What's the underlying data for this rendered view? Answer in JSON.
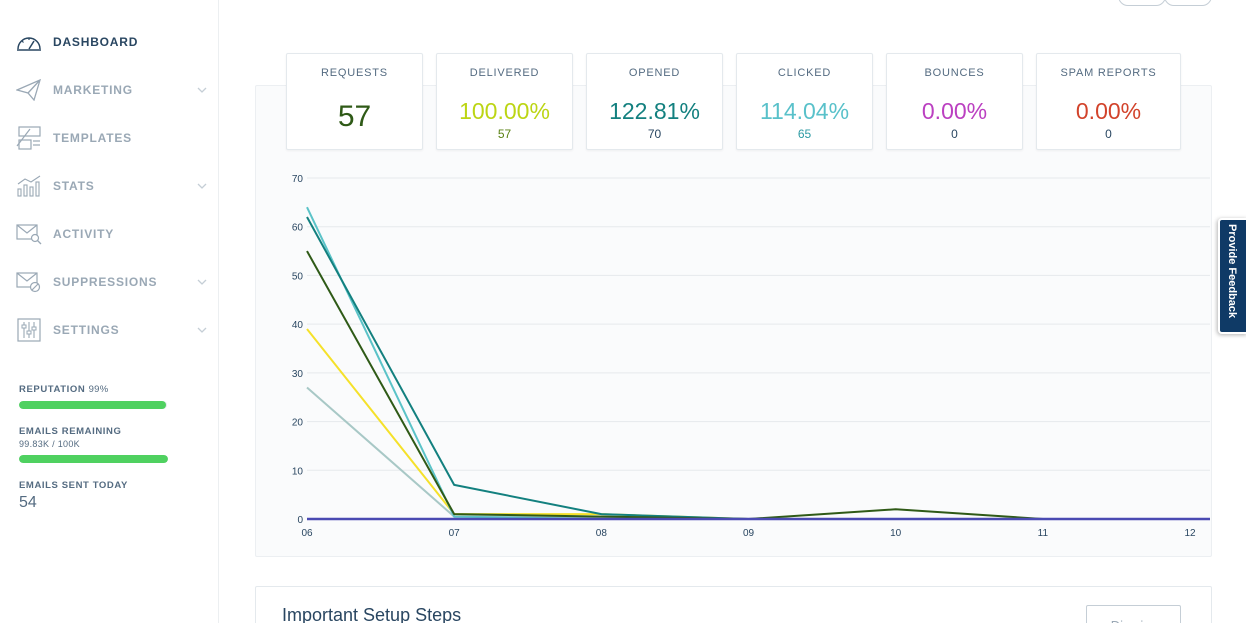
{
  "sidebar": {
    "items": [
      {
        "label": "DASHBOARD",
        "icon": "dashboard-gauge-icon",
        "active": true,
        "chevron": false
      },
      {
        "label": "MARKETING",
        "icon": "paper-plane-icon",
        "active": false,
        "chevron": true
      },
      {
        "label": "TEMPLATES",
        "icon": "templates-icon",
        "active": false,
        "chevron": false
      },
      {
        "label": "STATS",
        "icon": "stats-chart-icon",
        "active": false,
        "chevron": true
      },
      {
        "label": "ACTIVITY",
        "icon": "activity-search-icon",
        "active": false,
        "chevron": false
      },
      {
        "label": "SUPPRESSIONS",
        "icon": "suppressions-icon",
        "active": false,
        "chevron": true
      },
      {
        "label": "SETTINGS",
        "icon": "settings-sliders-icon",
        "active": false,
        "chevron": true
      }
    ],
    "reputation": {
      "label": "REPUTATION",
      "value": "99%",
      "fraction": 0.99
    },
    "emails_remaining": {
      "label": "EMAILS REMAINING",
      "value": "99.83K / 100K",
      "fraction": 0.998
    },
    "emails_sent_today": {
      "label": "EMAILS SENT TODAY",
      "value": "54"
    }
  },
  "stats": {
    "requests": {
      "label": "REQUESTS",
      "value": "57",
      "color": "#2f5a17"
    },
    "delivered": {
      "label": "DELIVERED",
      "pct": "100.00%",
      "count": "57",
      "color": "#bcd514"
    },
    "opened": {
      "label": "OPENED",
      "pct": "122.81%",
      "count": "70",
      "color": "#13807f",
      "count_color": "#294661"
    },
    "clicked": {
      "label": "CLICKED",
      "pct": "114.04%",
      "count": "65",
      "color": "#59c1ca"
    },
    "bounces": {
      "label": "BOUNCES",
      "pct": "0.00%",
      "count": "0",
      "color": "#bb40c1",
      "count_color": "#294661"
    },
    "spam": {
      "label": "SPAM REPORTS",
      "pct": "0.00%",
      "count": "0",
      "color": "#d2432b",
      "count_color": "#294661"
    }
  },
  "chart_data": {
    "type": "line",
    "x": [
      "06",
      "07",
      "08",
      "09",
      "10",
      "11",
      "12"
    ],
    "ylim": [
      0,
      70
    ],
    "yticks": [
      0,
      10,
      20,
      30,
      40,
      50,
      60,
      70
    ],
    "grid": true,
    "series": [
      {
        "color": "#a8c8c6",
        "values": [
          27,
          0.5,
          0.5,
          0,
          0,
          0,
          0
        ]
      },
      {
        "color": "#f5e12a",
        "values": [
          39,
          1,
          1,
          0,
          0,
          0,
          0
        ]
      },
      {
        "color": "#5bc3c8",
        "values": [
          64,
          0.5,
          0,
          0,
          0,
          0,
          0
        ]
      },
      {
        "color": "#13807f",
        "values": [
          62,
          7,
          1,
          0,
          0,
          0,
          0
        ]
      },
      {
        "color": "#2f5a17",
        "values": [
          55,
          1,
          0.5,
          0,
          2,
          0,
          0
        ]
      },
      {
        "color": "#4a4ab2",
        "values": [
          0,
          0,
          0,
          0,
          0,
          0,
          0
        ]
      }
    ]
  },
  "setup": {
    "title": "Important Setup Steps",
    "dismiss": "Dismiss"
  },
  "feedback": {
    "label": "Provide Feedback"
  }
}
